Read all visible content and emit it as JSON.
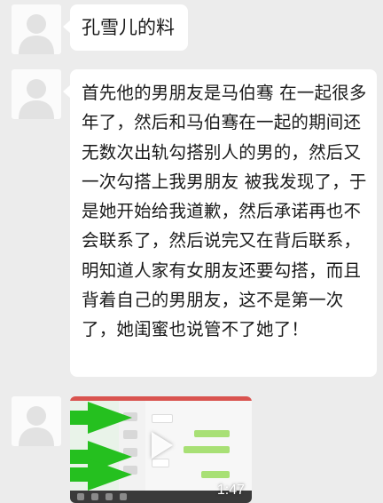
{
  "messages": [
    {
      "type": "text",
      "text": "孔雪儿的料"
    },
    {
      "type": "text",
      "text": "首先他的男朋友是马伯骞 在一起很多年了，然后和马伯骞在一起的期间还无数次出轨勾搭别人的男的，然后又一次勾搭上我男朋友 被我发现了，于是她开始给我道歉，然后承诺再也不会联系了，然后说完又在背后联系，明知道人家有女朋友还要勾搭，而且背着自己的男朋友，这不是第一次了，她闺蜜也说管不了她了！"
    },
    {
      "type": "video",
      "duration": "1:47"
    }
  ],
  "colors": {
    "background": "#ececec",
    "bubble": "#ffffff",
    "arrow": "#25c01f"
  },
  "icons": {
    "avatar": "default-avatar-icon",
    "play": "play-icon",
    "annotation": "green-arrow-icon"
  }
}
